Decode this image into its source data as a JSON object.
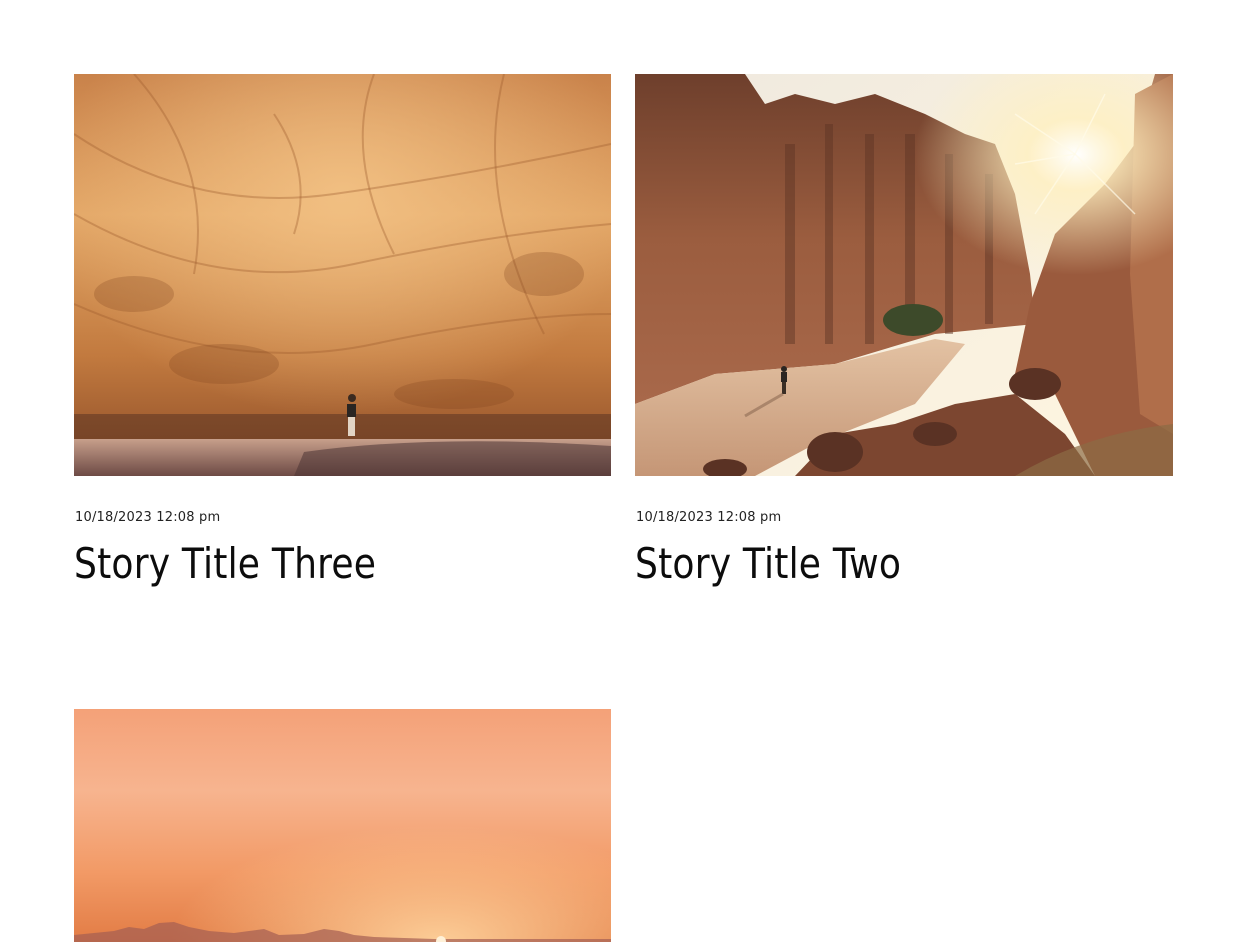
{
  "stories": [
    {
      "date": "10/18/2023 12:08 pm",
      "title": "Story Title Three",
      "image": "desert-cliff-with-hiker-photo"
    },
    {
      "date": "10/18/2023 12:08 pm",
      "title": "Story Title Two",
      "image": "desert-canyon-sunburst-photo"
    },
    {
      "date": "",
      "title": "",
      "image": "desert-sunset-photo"
    }
  ],
  "colors": {
    "cliff": "#d08a4a",
    "canyon": "#8a5238",
    "sunset": "#f4a279"
  }
}
